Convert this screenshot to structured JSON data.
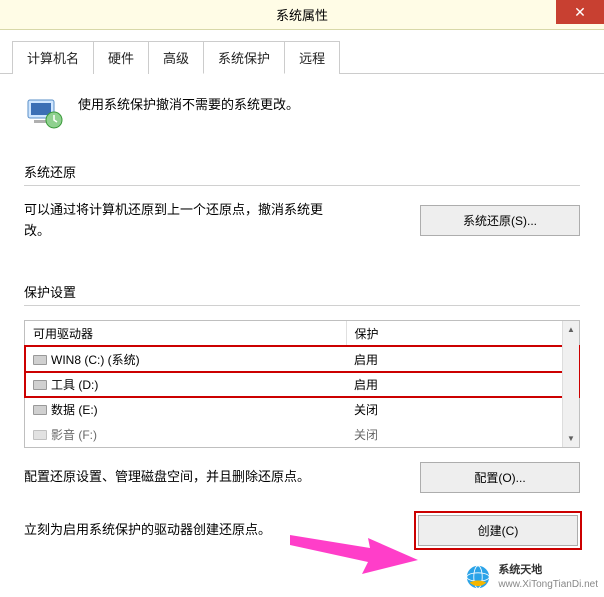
{
  "titlebar": {
    "title": "系统属性"
  },
  "tabs": {
    "items": [
      {
        "label": "计算机名"
      },
      {
        "label": "硬件"
      },
      {
        "label": "高级"
      },
      {
        "label": "系统保护"
      },
      {
        "label": "远程"
      }
    ],
    "active_index": 3
  },
  "intro": {
    "text": "使用系统保护撤消不需要的系统更改。"
  },
  "restore_section": {
    "heading": "系统还原",
    "description": "可以通过将计算机还原到上一个还原点，撤消系统更改。",
    "button_label": "系统还原(S)..."
  },
  "protection_section": {
    "heading": "保护设置",
    "columns": {
      "drive": "可用驱动器",
      "protection": "保护"
    },
    "rows": [
      {
        "name": "WIN8 (C:) (系统)",
        "status": "启用"
      },
      {
        "name": "工具 (D:)",
        "status": "启用"
      },
      {
        "name": "数据 (E:)",
        "status": "关闭"
      },
      {
        "name": "影音 (F:)",
        "status": "关闭"
      }
    ]
  },
  "configure": {
    "description": "配置还原设置、管理磁盘空间，并且删除还原点。",
    "button_label": "配置(O)..."
  },
  "create": {
    "description": "立刻为启用系统保护的驱动器创建还原点。",
    "button_label": "创建(C)"
  },
  "watermark": {
    "name": "系统天地",
    "url": "www.XiTongTianDi.net"
  }
}
